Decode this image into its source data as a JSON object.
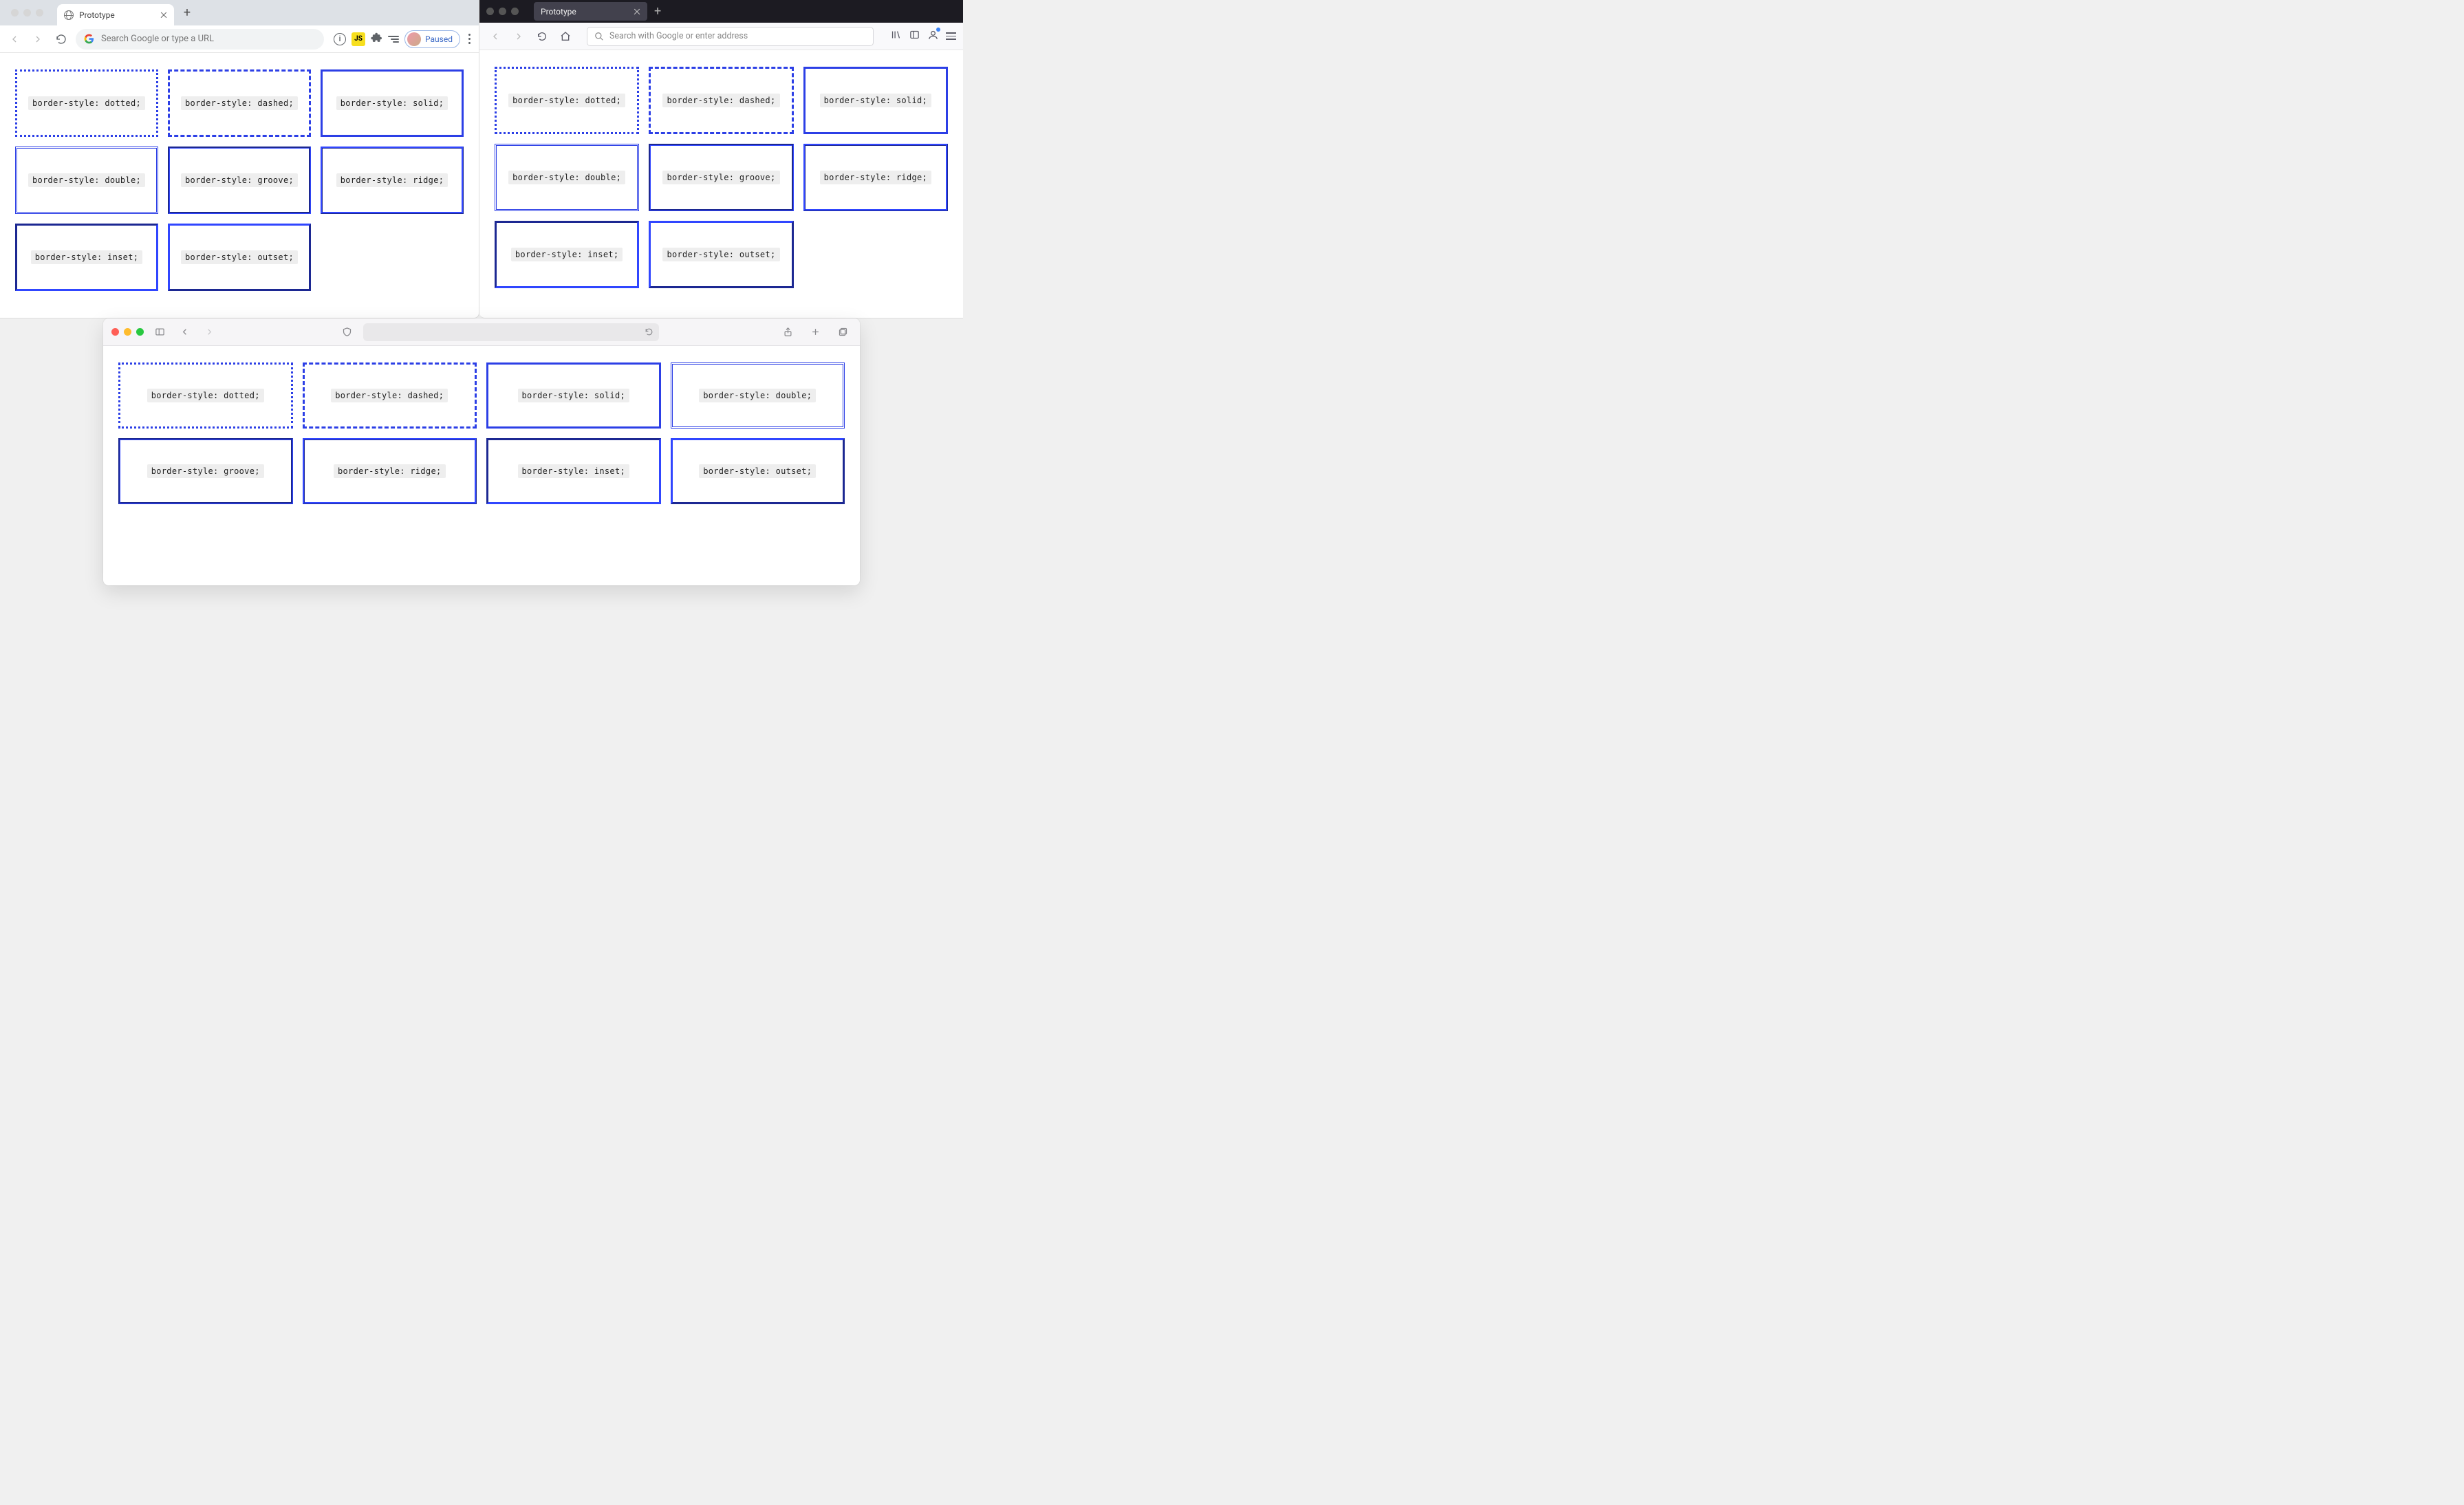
{
  "chrome": {
    "tab_title": "Prototype",
    "omnibox_placeholder": "Search Google or type a URL",
    "paused_label": "Paused"
  },
  "firefox": {
    "tab_title": "Prototype",
    "urlbar_placeholder": "Search with Google or enter address"
  },
  "border_styles": [
    {
      "name": "dotted",
      "label": "border-style: dotted;"
    },
    {
      "name": "dashed",
      "label": "border-style: dashed;"
    },
    {
      "name": "solid",
      "label": "border-style: solid;"
    },
    {
      "name": "double",
      "label": "border-style: double;"
    },
    {
      "name": "groove",
      "label": "border-style: groove;"
    },
    {
      "name": "ridge",
      "label": "border-style: ridge;"
    },
    {
      "name": "inset",
      "label": "border-style: inset;"
    },
    {
      "name": "outset",
      "label": "border-style: outset;"
    }
  ],
  "border_color": "#2c3fe6"
}
